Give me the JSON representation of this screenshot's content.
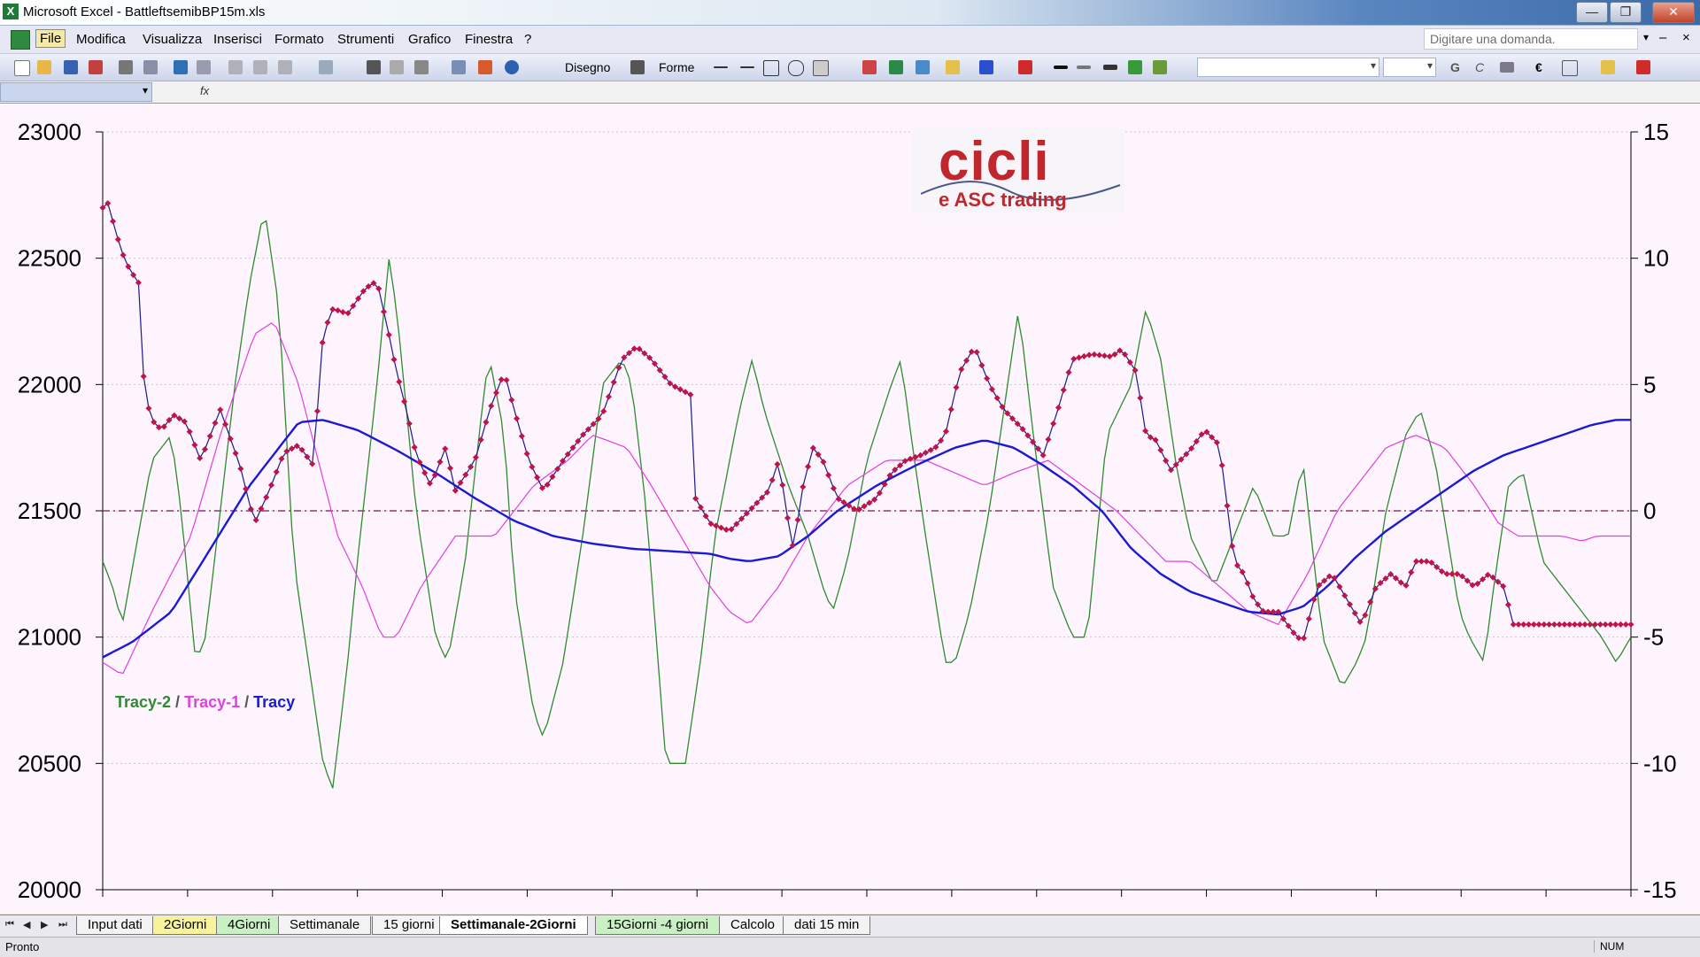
{
  "window": {
    "title": "Microsoft Excel - BattleftsemibBP15m.xls",
    "buttons": {
      "minimize": "—",
      "maximize": "❐",
      "close": "✕"
    }
  },
  "menu": {
    "items": [
      "File",
      "Modifica",
      "Visualizza",
      "Inserisci",
      "Formato",
      "Strumenti",
      "Grafico",
      "Finestra",
      "?"
    ],
    "help_placeholder": "Digitare una domanda."
  },
  "toolbar": {
    "draw_label": "Disegno",
    "shapes_label": "Forme",
    "bold_label": "G",
    "italic_label": "C",
    "euro_label": "€"
  },
  "formula": {
    "fx_label": "fx"
  },
  "chart": {
    "logo_main": "cicli",
    "logo_sub": "e ASC trading",
    "legend": {
      "tracy2": "Tracy-2",
      "tracy1": "Tracy-1",
      "tracy": "Tracy",
      "sep": " / "
    },
    "colors": {
      "tracy2": "#2e8b2e",
      "tracy1": "#e040e0",
      "tracy": "#1a1ad6",
      "price": "#1a1a8c",
      "marker": "#c0134a"
    }
  },
  "chart_data": {
    "type": "line",
    "y_left": {
      "min": 20000,
      "max": 23000,
      "ticks": [
        23000,
        22500,
        22000,
        21500,
        21000,
        20500,
        20000
      ]
    },
    "y_right": {
      "min": -15,
      "max": 15,
      "ticks": [
        15,
        10,
        5,
        0,
        -5,
        -10,
        -15
      ]
    },
    "zero_line": 0,
    "x_count": 300,
    "series": [
      {
        "name": "Tracy-2",
        "axis": "right",
        "knots": [
          [
            0,
            -2
          ],
          [
            10,
            -3
          ],
          [
            20,
            -4.5
          ],
          [
            50,
            2
          ],
          [
            70,
            3
          ],
          [
            80,
            0
          ],
          [
            95,
            -6
          ],
          [
            105,
            -5
          ],
          [
            120,
            0
          ],
          [
            135,
            5
          ],
          [
            150,
            9
          ],
          [
            165,
            12
          ],
          [
            180,
            8
          ],
          [
            195,
            -2
          ],
          [
            225,
            -10
          ],
          [
            235,
            -11
          ],
          [
            250,
            -6
          ],
          [
            260,
            -2
          ],
          [
            280,
            5
          ],
          [
            292,
            10
          ],
          [
            300,
            8
          ],
          [
            320,
            0
          ],
          [
            340,
            -5
          ],
          [
            352,
            -6
          ],
          [
            370,
            -2
          ],
          [
            390,
            5
          ],
          [
            395,
            6
          ],
          [
            410,
            3
          ],
          [
            420,
            -3
          ],
          [
            440,
            -8
          ],
          [
            450,
            -9
          ],
          [
            470,
            -6
          ],
          [
            490,
            -1
          ],
          [
            510,
            5
          ],
          [
            530,
            6
          ],
          [
            540,
            5
          ],
          [
            555,
            0
          ],
          [
            575,
            -10
          ],
          [
            595,
            -10
          ],
          [
            610,
            -6
          ],
          [
            625,
            -1
          ],
          [
            650,
            4
          ],
          [
            663,
            6
          ],
          [
            675,
            4
          ],
          [
            700,
            1
          ],
          [
            720,
            -1
          ],
          [
            735,
            -3
          ],
          [
            745,
            -4
          ],
          [
            760,
            -2
          ],
          [
            780,
            2
          ],
          [
            805,
            5
          ],
          [
            815,
            6
          ],
          [
            825,
            3
          ],
          [
            840,
            -1
          ],
          [
            860,
            -6
          ],
          [
            870,
            -6
          ],
          [
            885,
            -4
          ],
          [
            905,
            0
          ],
          [
            935,
            8
          ],
          [
            950,
            3
          ],
          [
            970,
            -3
          ],
          [
            990,
            -5
          ],
          [
            1005,
            -5
          ],
          [
            1025,
            3
          ],
          [
            1050,
            5
          ],
          [
            1065,
            8
          ],
          [
            1080,
            6
          ],
          [
            1095,
            2
          ],
          [
            1110,
            -1
          ],
          [
            1135,
            -3
          ],
          [
            1155,
            -1
          ],
          [
            1175,
            1
          ],
          [
            1195,
            -1
          ],
          [
            1210,
            -1
          ],
          [
            1225,
            2
          ],
          [
            1245,
            -5
          ],
          [
            1265,
            -7
          ],
          [
            1280,
            -6
          ],
          [
            1290,
            -5
          ],
          [
            1310,
            0
          ],
          [
            1330,
            3
          ],
          [
            1345,
            4
          ],
          [
            1360,
            2
          ],
          [
            1385,
            -4
          ],
          [
            1395,
            -5
          ],
          [
            1410,
            -6
          ],
          [
            1420,
            -3
          ],
          [
            1435,
            1
          ],
          [
            1450,
            1.5
          ],
          [
            1470,
            -2
          ],
          [
            1490,
            -3
          ],
          [
            1510,
            -4
          ],
          [
            1530,
            -5
          ],
          [
            1545,
            -6
          ],
          [
            1560,
            -5
          ]
        ]
      },
      {
        "name": "Tracy-1",
        "axis": "right",
        "knots": [
          [
            0,
            -6
          ],
          [
            20,
            -6.5
          ],
          [
            50,
            -4
          ],
          [
            90,
            -1
          ],
          [
            120,
            3
          ],
          [
            155,
            7
          ],
          [
            175,
            7.5
          ],
          [
            200,
            5
          ],
          [
            220,
            2
          ],
          [
            240,
            -1
          ],
          [
            265,
            -3
          ],
          [
            285,
            -5
          ],
          [
            300,
            -5
          ],
          [
            325,
            -3
          ],
          [
            360,
            -1
          ],
          [
            400,
            -1
          ],
          [
            440,
            1
          ],
          [
            475,
            2
          ],
          [
            500,
            3
          ],
          [
            535,
            2.5
          ],
          [
            560,
            1
          ],
          [
            590,
            -1
          ],
          [
            620,
            -3
          ],
          [
            640,
            -4
          ],
          [
            660,
            -4.5
          ],
          [
            690,
            -3
          ],
          [
            720,
            -1
          ],
          [
            760,
            1
          ],
          [
            800,
            2
          ],
          [
            840,
            2
          ],
          [
            870,
            1.5
          ],
          [
            900,
            1
          ],
          [
            930,
            1.5
          ],
          [
            965,
            2
          ],
          [
            1000,
            1
          ],
          [
            1035,
            0
          ],
          [
            1060,
            -1
          ],
          [
            1085,
            -2
          ],
          [
            1110,
            -2
          ],
          [
            1140,
            -3
          ],
          [
            1170,
            -4
          ],
          [
            1200,
            -4.5
          ],
          [
            1230,
            -2.5
          ],
          [
            1260,
            0
          ],
          [
            1290,
            1.5
          ],
          [
            1310,
            2.5
          ],
          [
            1340,
            3
          ],
          [
            1370,
            2.5
          ],
          [
            1400,
            1
          ],
          [
            1425,
            -0.5
          ],
          [
            1445,
            -1
          ],
          [
            1470,
            -1
          ],
          [
            1490,
            -1
          ],
          [
            1510,
            -1.2
          ],
          [
            1525,
            -1
          ]
        ]
      },
      {
        "name": "Tracy",
        "axis": "right",
        "knots": [
          [
            0,
            -5.8
          ],
          [
            30,
            -5.2
          ],
          [
            70,
            -4
          ],
          [
            110,
            -1.5
          ],
          [
            150,
            1
          ],
          [
            180,
            2.5
          ],
          [
            200,
            3.5
          ],
          [
            225,
            3.6
          ],
          [
            260,
            3.2
          ],
          [
            300,
            2.4
          ],
          [
            340,
            1.5
          ],
          [
            380,
            0.5
          ],
          [
            420,
            -0.4
          ],
          [
            460,
            -1
          ],
          [
            500,
            -1.3
          ],
          [
            540,
            -1.5
          ],
          [
            580,
            -1.6
          ],
          [
            620,
            -1.7
          ],
          [
            640,
            -1.9
          ],
          [
            660,
            -2
          ],
          [
            690,
            -1.8
          ],
          [
            720,
            -1
          ],
          [
            750,
            0
          ],
          [
            790,
            1
          ],
          [
            830,
            1.8
          ],
          [
            870,
            2.5
          ],
          [
            900,
            2.8
          ],
          [
            930,
            2.5
          ],
          [
            960,
            1.8
          ],
          [
            990,
            1
          ],
          [
            1020,
            0
          ],
          [
            1050,
            -1.5
          ],
          [
            1080,
            -2.5
          ],
          [
            1110,
            -3.2
          ],
          [
            1140,
            -3.6
          ],
          [
            1170,
            -4
          ],
          [
            1200,
            -4.1
          ],
          [
            1225,
            -3.8
          ],
          [
            1250,
            -3
          ],
          [
            1280,
            -1.8
          ],
          [
            1310,
            -0.8
          ],
          [
            1340,
            0
          ],
          [
            1370,
            0.8
          ],
          [
            1400,
            1.6
          ],
          [
            1430,
            2.2
          ],
          [
            1460,
            2.6
          ],
          [
            1490,
            3
          ],
          [
            1520,
            3.4
          ],
          [
            1545,
            3.6
          ]
        ]
      },
      {
        "name": "",
        "axis": "left",
        "markers": true,
        "knots": [
          [
            0,
            22700
          ],
          [
            6,
            22720
          ],
          [
            12,
            22620
          ],
          [
            20,
            22520
          ],
          [
            28,
            22450
          ],
          [
            34,
            22420
          ],
          [
            40,
            22380
          ],
          [
            42,
            21980
          ],
          [
            50,
            21860
          ],
          [
            60,
            21820
          ],
          [
            72,
            21880
          ],
          [
            85,
            21850
          ],
          [
            100,
            21700
          ],
          [
            120,
            21900
          ],
          [
            140,
            21680
          ],
          [
            155,
            21450
          ],
          [
            170,
            21580
          ],
          [
            185,
            21730
          ],
          [
            200,
            21760
          ],
          [
            215,
            21680
          ],
          [
            225,
            22200
          ],
          [
            235,
            22300
          ],
          [
            250,
            22280
          ],
          [
            268,
            22380
          ],
          [
            280,
            22410
          ],
          [
            292,
            22200
          ],
          [
            300,
            22050
          ],
          [
            310,
            21900
          ],
          [
            320,
            21720
          ],
          [
            335,
            21600
          ],
          [
            350,
            21750
          ],
          [
            360,
            21580
          ],
          [
            380,
            21700
          ],
          [
            395,
            21900
          ],
          [
            410,
            22050
          ],
          [
            420,
            21900
          ],
          [
            435,
            21700
          ],
          [
            450,
            21580
          ],
          [
            470,
            21700
          ],
          [
            490,
            21800
          ],
          [
            510,
            21880
          ],
          [
            530,
            22100
          ],
          [
            545,
            22150
          ],
          [
            560,
            22100
          ],
          [
            580,
            22000
          ],
          [
            600,
            21960
          ],
          [
            605,
            21550
          ],
          [
            620,
            21450
          ],
          [
            640,
            21420
          ],
          [
            660,
            21500
          ],
          [
            680,
            21580
          ],
          [
            690,
            21700
          ],
          [
            700,
            21450
          ],
          [
            705,
            21350
          ],
          [
            715,
            21600
          ],
          [
            725,
            21750
          ],
          [
            735,
            21700
          ],
          [
            750,
            21550
          ],
          [
            770,
            21500
          ],
          [
            790,
            21550
          ],
          [
            805,
            21650
          ],
          [
            820,
            21700
          ],
          [
            835,
            21720
          ],
          [
            850,
            21750
          ],
          [
            860,
            21800
          ],
          [
            875,
            22050
          ],
          [
            890,
            22150
          ],
          [
            905,
            22000
          ],
          [
            920,
            21900
          ],
          [
            940,
            21820
          ],
          [
            960,
            21720
          ],
          [
            975,
            21900
          ],
          [
            990,
            22100
          ],
          [
            1010,
            22120
          ],
          [
            1030,
            22110
          ],
          [
            1040,
            22140
          ],
          [
            1055,
            22050
          ],
          [
            1065,
            21800
          ],
          [
            1075,
            21780
          ],
          [
            1090,
            21660
          ],
          [
            1110,
            21740
          ],
          [
            1125,
            21820
          ],
          [
            1140,
            21760
          ],
          [
            1155,
            21300
          ],
          [
            1165,
            21250
          ],
          [
            1175,
            21150
          ],
          [
            1185,
            21100
          ],
          [
            1200,
            21100
          ],
          [
            1215,
            21020
          ],
          [
            1225,
            20980
          ],
          [
            1240,
            21200
          ],
          [
            1255,
            21250
          ],
          [
            1270,
            21150
          ],
          [
            1285,
            21050
          ],
          [
            1300,
            21200
          ],
          [
            1315,
            21250
          ],
          [
            1330,
            21200
          ],
          [
            1340,
            21300
          ],
          [
            1355,
            21300
          ],
          [
            1370,
            21250
          ],
          [
            1385,
            21250
          ],
          [
            1400,
            21200
          ],
          [
            1415,
            21250
          ],
          [
            1430,
            21200
          ],
          [
            1440,
            21050
          ],
          [
            1450,
            21050
          ]
        ]
      }
    ]
  },
  "sheets": {
    "tabs": [
      "Input dati",
      "2Giorni",
      "4Giorni",
      "Settimanale",
      "15 giorni",
      "Settimanale-2Giorni",
      "15Giorni -4 giorni",
      "Calcolo",
      "dati 15 min"
    ],
    "active": "Settimanale-2Giorni"
  },
  "status": {
    "text": "Pronto",
    "num": "NUM"
  }
}
